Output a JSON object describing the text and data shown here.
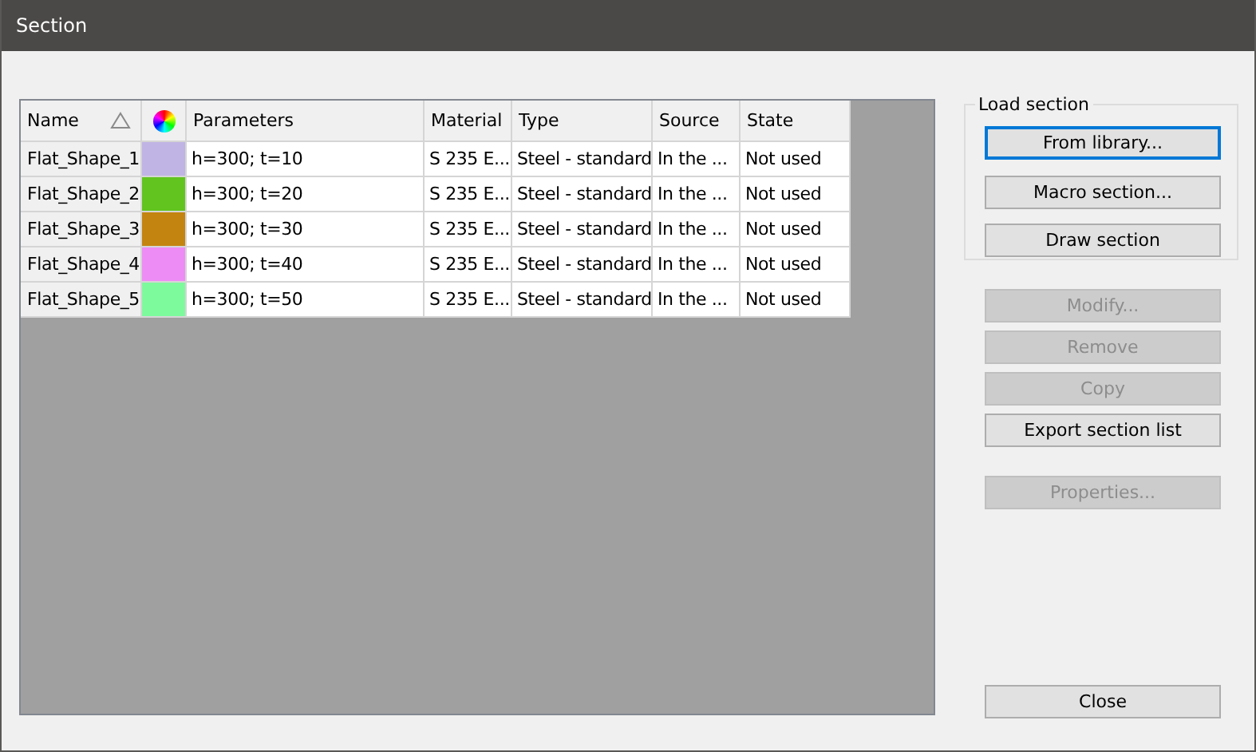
{
  "window": {
    "title": "Section"
  },
  "table": {
    "columns": [
      {
        "kind": "text",
        "label": "Name",
        "sorted": true
      },
      {
        "kind": "color"
      },
      {
        "kind": "text",
        "label": "Parameters"
      },
      {
        "kind": "text",
        "label": "Material"
      },
      {
        "kind": "text",
        "label": "Type"
      },
      {
        "kind": "text",
        "label": "Source"
      },
      {
        "kind": "text",
        "label": "State"
      }
    ],
    "rows": [
      {
        "name": "Flat_Shape_1",
        "color": "#c0b4e4",
        "parameters": "h=300; t=10",
        "material": "S 235 E...",
        "type": "Steel - standard",
        "source": "In the ...",
        "state": "Not used"
      },
      {
        "name": "Flat_Shape_2",
        "color": "#62c41f",
        "parameters": "h=300; t=20",
        "material": "S 235 E...",
        "type": "Steel - standard",
        "source": "In the ...",
        "state": "Not used"
      },
      {
        "name": "Flat_Shape_3",
        "color": "#c48410",
        "parameters": "h=300; t=30",
        "material": "S 235 E...",
        "type": "Steel - standard",
        "source": "In the ...",
        "state": "Not used"
      },
      {
        "name": "Flat_Shape_4",
        "color": "#ee8cf5",
        "parameters": "h=300; t=40",
        "material": "S 235 E...",
        "type": "Steel - standard",
        "source": "In the ...",
        "state": "Not used"
      },
      {
        "name": "Flat_Shape_5",
        "color": "#7dfa9c",
        "parameters": "h=300; t=50",
        "material": "S 235 E...",
        "type": "Steel - standard",
        "source": "In the ...",
        "state": "Not used"
      }
    ]
  },
  "load_section": {
    "title": "Load section",
    "buttons": [
      {
        "label": "From library...",
        "focused": true,
        "disabled": false
      },
      {
        "label": "Macro section...",
        "focused": false,
        "disabled": false
      },
      {
        "label": "Draw section",
        "focused": false,
        "disabled": false
      }
    ]
  },
  "action_groups": [
    [
      {
        "label": "Modify...",
        "disabled": true
      },
      {
        "label": "Remove",
        "disabled": true
      },
      {
        "label": "Copy",
        "disabled": true
      },
      {
        "label": "Export section list",
        "disabled": false
      }
    ],
    [
      {
        "label": "Properties...",
        "disabled": true
      }
    ]
  ],
  "close_button": {
    "label": "Close",
    "disabled": false
  }
}
